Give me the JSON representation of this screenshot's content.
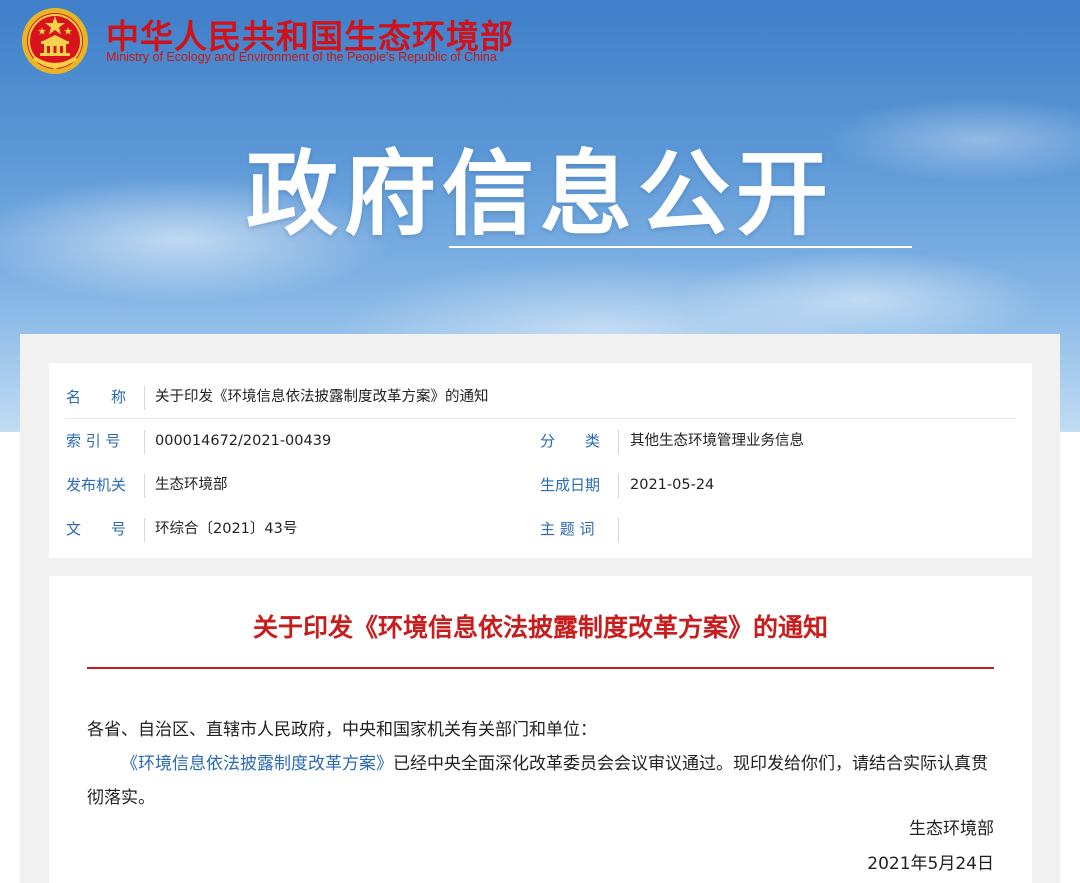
{
  "header": {
    "ministry_cn": "中华人民共和国生态环境部",
    "ministry_en": "Ministry of Ecology and Environment of the People's Republic of China",
    "emblem_icon": "national-emblem-icon",
    "brand_color": "#d0121b"
  },
  "banner": {
    "heading": "政府信息公开"
  },
  "meta": {
    "name_label": "名　　称",
    "name_value": "关于印发《环境信息依法披露制度改革方案》的通知",
    "index_label": "索 引 号",
    "index_value": "000014672/2021-00439",
    "category_label": "分　　类",
    "category_value": "其他生态环境管理业务信息",
    "publisher_label": "发布机关",
    "publisher_value": "生态环境部",
    "date_label": "生成日期",
    "date_value": "2021-05-24",
    "docno_label": "文　　号",
    "docno_value": "环综合〔2021〕43号",
    "keywords_label": "主 题 词",
    "keywords_value": "",
    "label_color": "#2a69b7"
  },
  "document": {
    "title": "关于印发《环境信息依法披露制度改革方案》的通知",
    "salutation": "各省、自治区、直辖市人民政府，中央和国家机关有关部门和单位：",
    "body_link": "《环境信息依法披露制度改革方案》",
    "body_text": "已经中央全面深化改革委员会会议审议通过。现印发给你们，请结合实际认真贯彻落实。",
    "signature": "生态环境部",
    "date": "2021年5月24日",
    "title_color": "#c81d1d"
  }
}
